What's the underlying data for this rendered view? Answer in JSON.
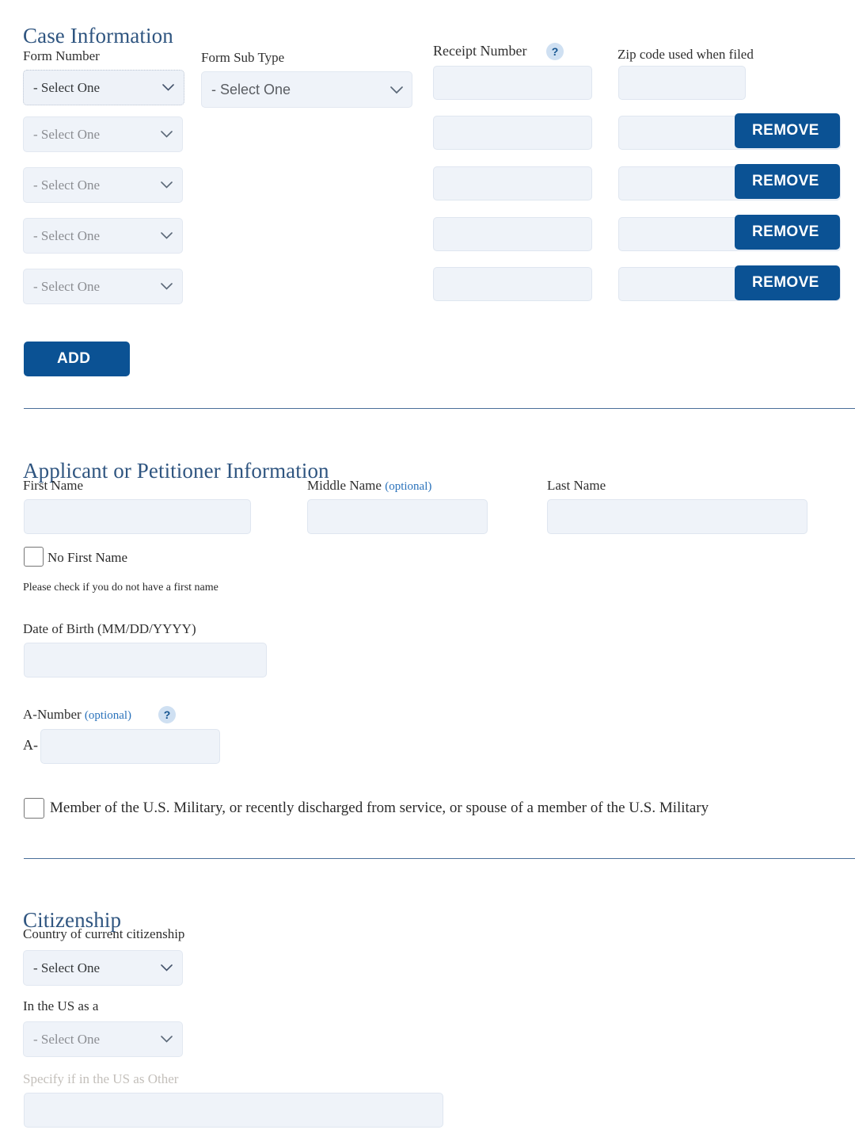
{
  "sections": {
    "case_information": {
      "heading": "Case Information",
      "labels": {
        "form_number": "Form Number",
        "form_sub_type": "Form Sub Type",
        "receipt_number": "Receipt Number",
        "zip_code": "Zip code used when filed"
      },
      "help_icon": "?",
      "select_placeholder": "- Select One",
      "form_number_rows": [
        {
          "value": "- Select One"
        },
        {
          "value": "- Select One"
        },
        {
          "value": "- Select One"
        },
        {
          "value": "- Select One"
        },
        {
          "value": "- Select One"
        }
      ],
      "form_sub_type_value": "- Select One",
      "receipt_number_rows": [
        "",
        "",
        "",
        "",
        ""
      ],
      "zip_code_rows": [
        "",
        "",
        "",
        "",
        ""
      ],
      "remove_label": "REMOVE",
      "remove_count": 4,
      "add_label": "ADD"
    },
    "applicant": {
      "heading": "Applicant or Petitioner Information",
      "first_name_label": "First Name",
      "first_name_value": "",
      "middle_name_label": "Middle Name",
      "middle_name_optional": "(optional)",
      "middle_name_value": "",
      "last_name_label": "Last Name",
      "last_name_value": "",
      "no_first_name_label": "No First Name",
      "no_first_name_helper": "Please check if you do not have a first name",
      "dob_label": "Date of Birth (MM/DD/YYYY)",
      "dob_value": "",
      "a_number_label": "A-Number",
      "a_number_optional": "(optional)",
      "a_number_help_icon": "?",
      "a_number_prefix": "A-",
      "a_number_value": "",
      "military_label": "Member of the U.S. Military, or recently discharged from service, or spouse of a member of the U.S. Military"
    },
    "citizenship": {
      "heading": "Citizenship",
      "country_label": "Country of current citizenship",
      "country_value": "- Select One",
      "in_us_as_label": "In the US as a",
      "in_us_as_value": "- Select One",
      "specify_other_label": "Specify if in the US as Other",
      "specify_other_value": ""
    }
  },
  "colors": {
    "heading": "#2f5580",
    "primary_button": "#0b5294",
    "input_background": "#eff3f9",
    "input_border": "#dfe6f0",
    "optional_text": "#2a72bb",
    "help_icon_background": "#cfe0f2",
    "divider": "#4a6f9a",
    "muted_label": "#c3bfba"
  }
}
